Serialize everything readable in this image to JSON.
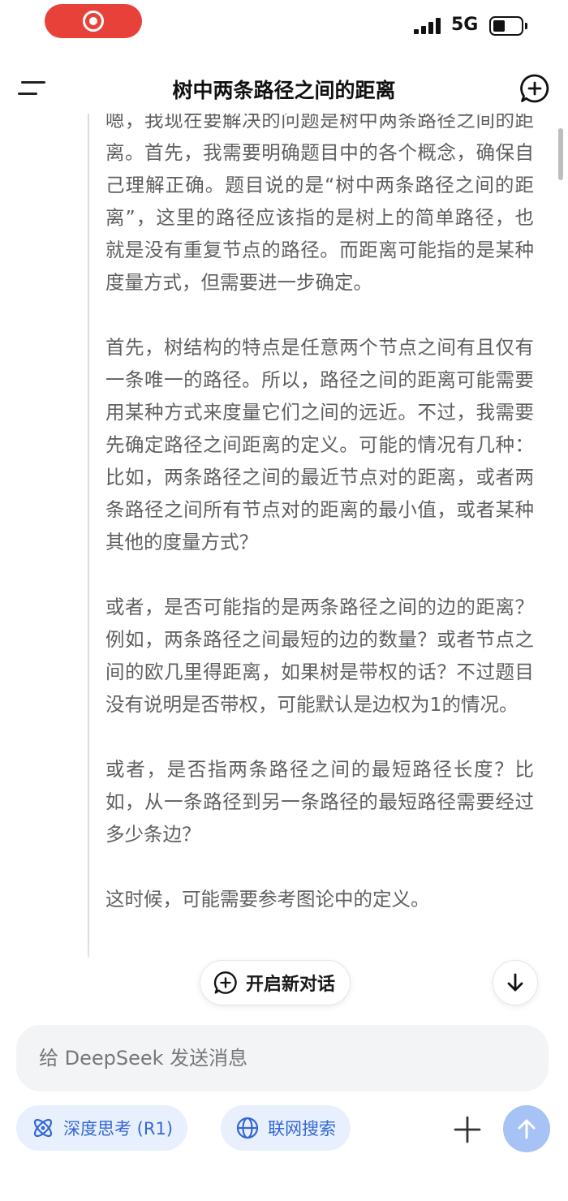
{
  "status_bar": {
    "network": "5G",
    "battery_level": 0.45
  },
  "header": {
    "title": "树中两条路径之间的距离"
  },
  "thought": {
    "paragraphs": [
      "嗯，我现在要解决的问题是树中两条路径之间的距离。首先，我需要明确题目中的各个概念，确保自己理解正确。题目说的是“树中两条路径之间的距离”，这里的路径应该指的是树上的简单路径，也就是没有重复节点的路径。而距离可能指的是某种度量方式，但需要进一步确定。",
      "首先，树结构的特点是任意两个节点之间有且仅有一条唯一的路径。所以，路径之间的距离可能需要用某种方式来度量它们之间的远近。不过，我需要先确定路径之间距离的定义。可能的情况有几种：比如，两条路径之间的最近节点对的距离，或者两条路径之间所有节点对的距离的最小值，或者某种其他的度量方式？",
      "或者，是否可能指的是两条路径之间的边的距离？例如，两条路径之间最短的边的数量？或者节点之间的欧几里得距离，如果树是带权的话？不过题目没有说明是否带权，可能默认是边权为1的情况。",
      "或者，是否指两条路径之间的最短路径长度？比如，从一条路径到另一条路径的最短路径需要经过多少条边？",
      "这时候，可能需要参考图论中的定义。"
    ]
  },
  "floating": {
    "new_chat_label": "开启新对话"
  },
  "composer": {
    "placeholder": "给 DeepSeek 发送消息",
    "deep_think_label": "深度思考 (R1)",
    "web_search_label": "联网搜索"
  },
  "colors": {
    "accent": "#3568d4",
    "chip_bg": "#e8f0fd",
    "send_disabled": "#a7c2f5",
    "record_red": "#e8413a"
  }
}
